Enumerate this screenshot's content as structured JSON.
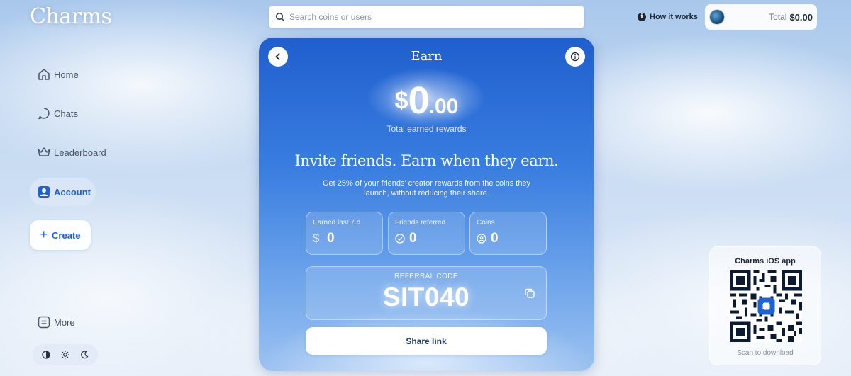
{
  "app": {
    "logo": "Charms"
  },
  "sidebar": {
    "items": [
      {
        "label": "Home",
        "icon": "home-icon"
      },
      {
        "label": "Chats",
        "icon": "chat-icon"
      },
      {
        "label": "Leaderboard",
        "icon": "crown-icon"
      },
      {
        "label": "Account",
        "icon": "account-icon",
        "active": true
      }
    ],
    "create_label": "Create",
    "more_label": "More",
    "theme_options": [
      "contrast-icon",
      "sun-icon",
      "moon-icon"
    ]
  },
  "header": {
    "search_placeholder": "Search coins or users",
    "how_it_works": "How it works",
    "total_label": "Total",
    "total_value": "$0.00"
  },
  "earn": {
    "title": "Earn",
    "amount_currency": "$",
    "amount_int": "0",
    "amount_dec": ".00",
    "amount_caption": "Total earned rewards",
    "headline": "Invite friends. Earn when they earn.",
    "description": "Get 25% of your friends' creator rewards from the coins they launch, without reducing their share.",
    "stats": [
      {
        "label": "Earned last 7 d",
        "symbol": "$",
        "value": "0"
      },
      {
        "label": "Friends referred",
        "icon": "check-circle-icon",
        "value": "0"
      },
      {
        "label": "Coins",
        "icon": "coin-icon",
        "value": "0"
      }
    ],
    "referral_label": "REFERRAL CODE",
    "referral_code": "SIT040",
    "share_label": "Share link"
  },
  "ios_app": {
    "title": "Charms iOS app",
    "caption": "Scan to download"
  },
  "colors": {
    "accent": "#1d63d6",
    "card_top": "#1f5fce",
    "card_bottom": "#9cc2f1"
  }
}
